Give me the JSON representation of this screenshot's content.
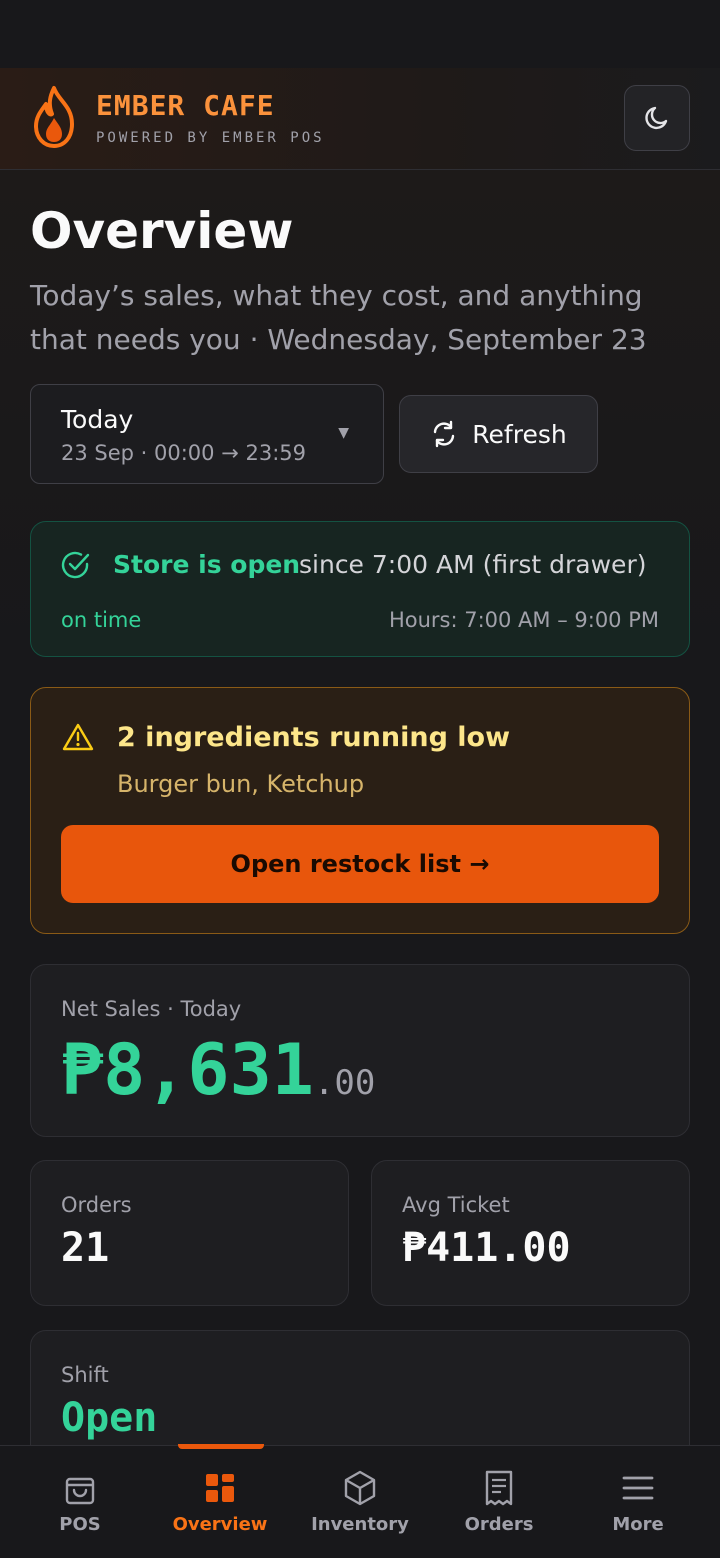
{
  "header": {
    "brand_name": "EMBER CAFE",
    "brand_sub": "POWERED BY EMBER POS",
    "theme_toggle_icon": "moon-icon"
  },
  "overview": {
    "title": "Overview",
    "subtitle": "Today’s sales, what they cost, and anything that needs you · Wednesday, September 23"
  },
  "range": {
    "label": "Today",
    "sub": "23 Sep · 00:00 → 23:59"
  },
  "refresh": {
    "label": "Refresh"
  },
  "store": {
    "status": "Store is open",
    "since": "since 7:00 AM (first drawer)",
    "punctuality": "on time",
    "hours": "Hours: 7:00 AM – 9:00 PM"
  },
  "low_stock": {
    "title": "2 ingredients running low",
    "items": "Burger bun, Ketchup",
    "button": "Open restock list →"
  },
  "net_sales": {
    "label": "Net Sales · Today",
    "value_main": "₱8,631",
    "value_decimal": ".00"
  },
  "orders": {
    "label": "Orders",
    "value": "21"
  },
  "avg_ticket": {
    "label": "Avg Ticket",
    "value": "₱411.00"
  },
  "shift": {
    "label": "Shift",
    "value": "Open"
  },
  "tabs": [
    {
      "label": "POS",
      "icon": "bag-icon"
    },
    {
      "label": "Overview",
      "icon": "dashboard-icon",
      "active": true
    },
    {
      "label": "Inventory",
      "icon": "box-icon"
    },
    {
      "label": "Orders",
      "icon": "receipt-icon"
    },
    {
      "label": "More",
      "icon": "menu-icon"
    }
  ],
  "colors": {
    "accent": "#ea580c",
    "success": "#34d399",
    "warning": "#fde68a",
    "background": "#18181b"
  }
}
